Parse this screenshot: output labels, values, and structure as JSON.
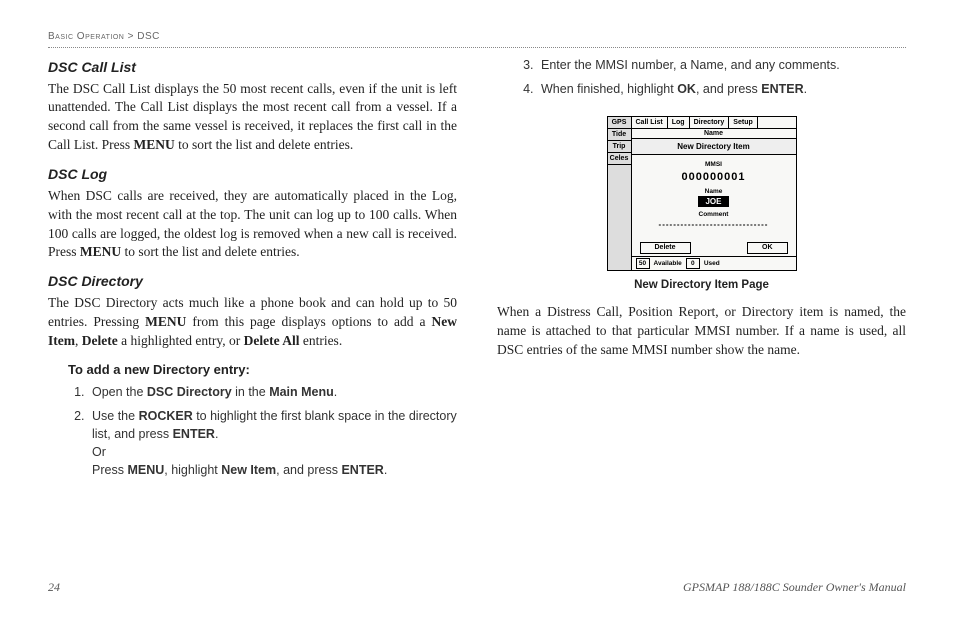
{
  "breadcrumb": {
    "section": "Basic Operation",
    "sep": ">",
    "page": "DSC"
  },
  "left": {
    "h1": "DSC Call List",
    "p1": "The DSC Call List displays the 50 most recent calls, even if the unit is left unattended. The Call List displays the most recent call from a vessel. If a second call from the same vessel is received, it replaces the first call in the Call List. Press ",
    "p1b": "MENU",
    "p1c": " to sort the list and delete entries.",
    "h2": "DSC Log",
    "p2": "When DSC calls are received, they are automatically placed in the Log, with the most recent call at the top. The unit can log up to 100 calls. When 100 calls are logged, the oldest log is removed when a new call is received. Press ",
    "p2b": "MENU",
    "p2c": " to sort the list and delete entries.",
    "h3": "DSC Directory",
    "p3": "The DSC Directory acts much like a phone book and can hold up to 50 entries. Pressing ",
    "p3b": "MENU",
    "p3c": " from this page displays options to add a ",
    "p3d": "New Item",
    "p3e": ", ",
    "p3f": "Delete",
    "p3g": " a highlighted entry, or ",
    "p3h": "Delete All",
    "p3i": " entries.",
    "sub": "To add a new Directory entry:",
    "li1a": "Open the ",
    "li1b": "DSC Directory",
    "li1c": " in the ",
    "li1d": "Main Menu",
    "li1e": ".",
    "li2a": "Use the ",
    "li2b": "ROCKER",
    "li2c": " to highlight the first blank space in the directory list, and press ",
    "li2d": "ENTER",
    "li2e": ".",
    "li2or": "Or",
    "li2f": "Press ",
    "li2g": "MENU",
    "li2h": ", highlight ",
    "li2i": "New Item",
    "li2j": ", and press ",
    "li2k": "ENTER",
    "li2l": "."
  },
  "right": {
    "li3": "Enter the MMSI number, a Name, and any comments.",
    "li4a": "When finished, highlight ",
    "li4b": "OK",
    "li4c": ", and press ",
    "li4d": "ENTER",
    "li4e": ".",
    "caption": "New Directory Item Page",
    "p1": "When a Distress Call, Position Report, or Directory item is named, the name is attached to that particular MMSI number. If a name is used, all DSC entries of the same MMSI number show the name."
  },
  "figure": {
    "side": [
      "GPS",
      "Tide",
      "Trip",
      "Celes"
    ],
    "tabs": [
      "Call List",
      "Log",
      "Directory",
      "Setup"
    ],
    "subtab": "Name",
    "title": "New Directory Item",
    "mmsi_label": "MMSI",
    "mmsi_value": "000000001",
    "name_label": "Name",
    "name_value": "JOE",
    "comment_label": "Comment",
    "comment_value": "------------------------------",
    "btn_delete": "Delete",
    "btn_ok": "OK",
    "status_avail_n": "50",
    "status_avail": "Available",
    "status_used_n": "0",
    "status_used": "Used"
  },
  "footer": {
    "pagenum": "24",
    "manual": "GPSMAP 188/188C Sounder Owner's Manual"
  }
}
